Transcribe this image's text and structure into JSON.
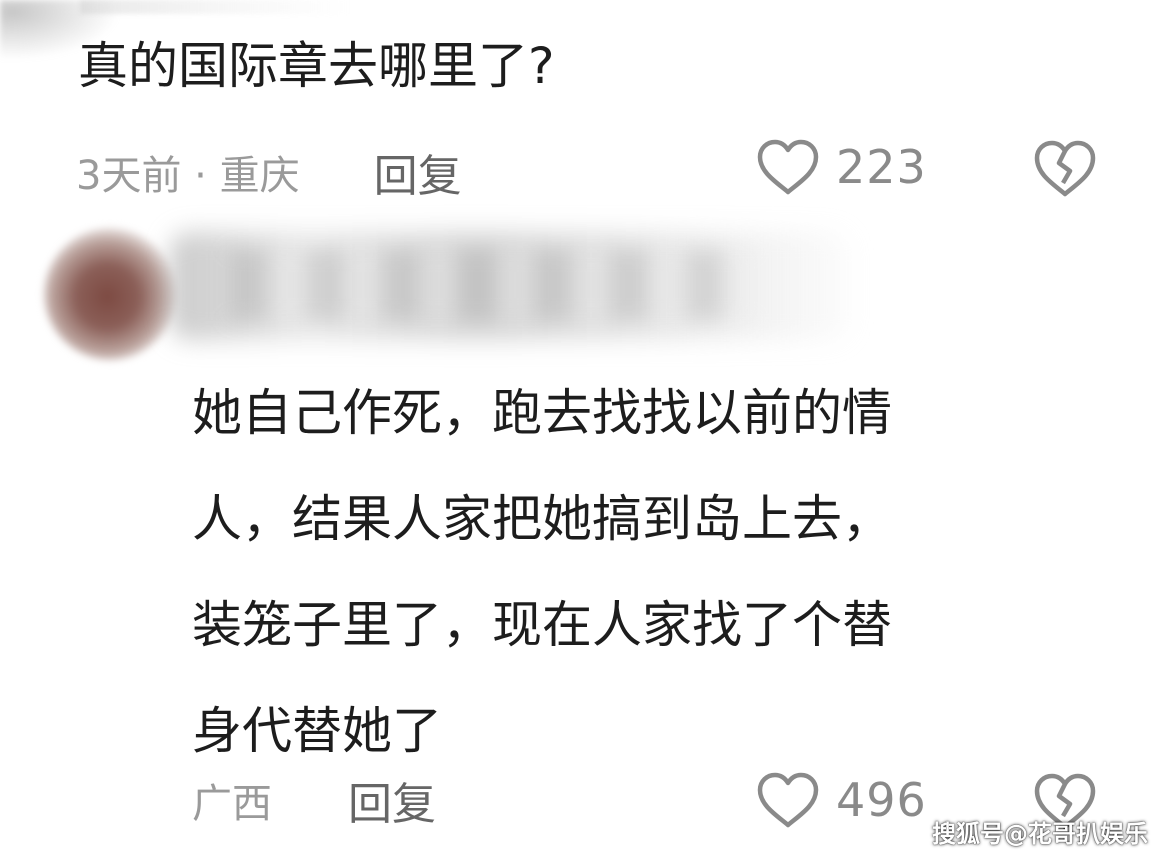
{
  "comment": {
    "text": "真的国际章去哪里了?",
    "time_location": "3天前 · 重庆",
    "reply_label": "回复",
    "like_count": "223",
    "icons": {
      "like": "heart-icon",
      "dislike": "broken-heart-icon"
    }
  },
  "reply": {
    "lines": [
      "她自己作死，跑去找找以前的情",
      "人，结果人家把她搞到岛上去，",
      "装笼子里了，现在人家找了个替",
      "身代替她了"
    ],
    "location": "广西",
    "reply_label": "回复",
    "like_count": "496",
    "icons": {
      "like": "heart-icon",
      "dislike": "broken-heart-icon"
    }
  },
  "watermark": "搜狐号@花哥扒娱乐",
  "colors": {
    "text": "#1d1d1d",
    "meta": "#9a9a9a",
    "reply": "#666666",
    "count": "#8a8a8a",
    "icon": "#8a8a8a"
  }
}
